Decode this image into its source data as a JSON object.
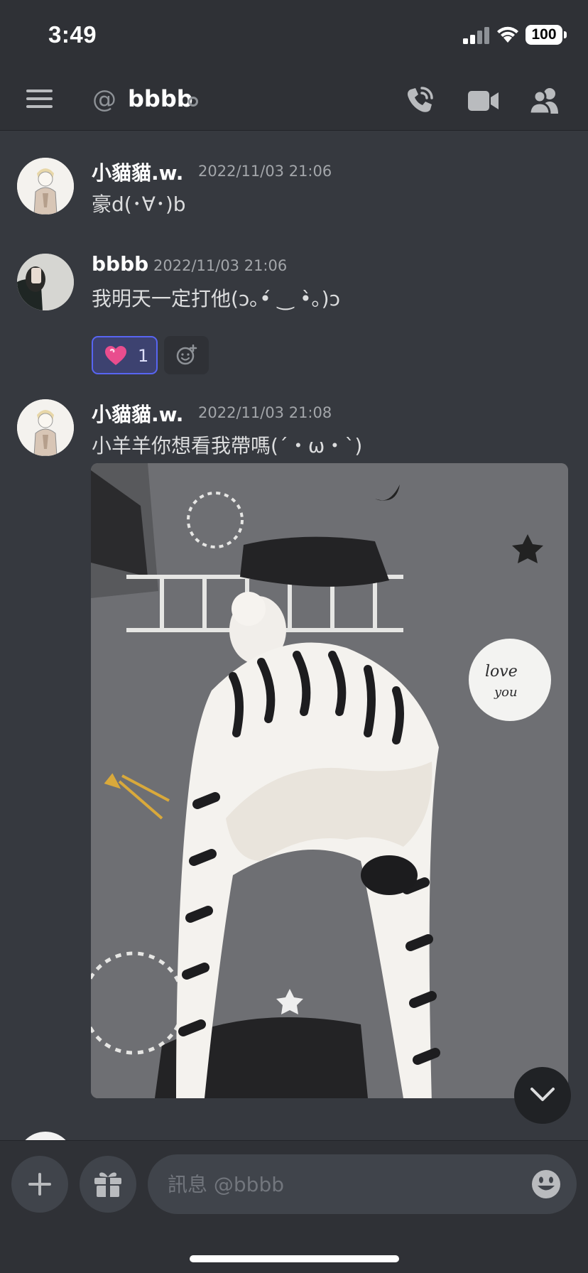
{
  "status_bar": {
    "time": "3:49",
    "battery": "100"
  },
  "header": {
    "channel_name": "bbbb"
  },
  "messages": [
    {
      "username": "小貓貓.w.",
      "timestamp": "2022/11/03 21:06",
      "content": "豪d(･∀･)b"
    },
    {
      "username": "bbbb",
      "timestamp": "2022/11/03 21:06",
      "content": "我明天一定打他(ↄ｡•́ ‿ •̀｡)ↄ",
      "reaction": {
        "emoji": "heart-icon",
        "count": "1"
      }
    },
    {
      "username": "小貓貓.w.",
      "timestamp": "2022/11/03 21:08",
      "content": "小羊羊你想看我帶嗎(´・ω・`)",
      "attachment": "photo"
    }
  ],
  "input": {
    "placeholder": "訊息 @bbbb"
  },
  "colors": {
    "background": "#36393f",
    "header": "#2f3136",
    "accent": "#5865f2",
    "text": "#dcddde",
    "muted": "#a3a6aa"
  }
}
